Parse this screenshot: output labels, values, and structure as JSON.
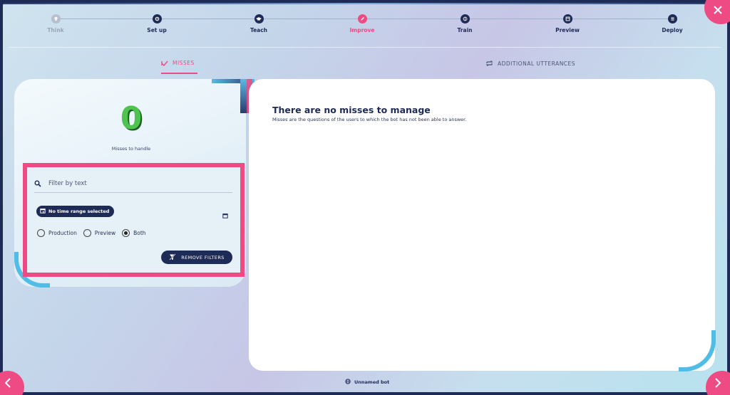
{
  "stepper": {
    "steps": [
      {
        "label": "Think",
        "state": "muted",
        "icon": "lightbulb-icon"
      },
      {
        "label": "Set up",
        "state": "done",
        "icon": "gear-icon"
      },
      {
        "label": "Teach",
        "state": "done",
        "icon": "graduation-cap-icon"
      },
      {
        "label": "Improve",
        "state": "active",
        "icon": "pencil-icon"
      },
      {
        "label": "Train",
        "state": "done",
        "icon": "brain-icon"
      },
      {
        "label": "Preview",
        "state": "done",
        "icon": "window-icon"
      },
      {
        "label": "Deploy",
        "state": "done",
        "icon": "list-icon"
      }
    ]
  },
  "tabs": {
    "misses": "MISSES",
    "additional": "ADDITIONAL UTTERANCES"
  },
  "counter": {
    "value": "0",
    "label": "Misses to handle"
  },
  "filters": {
    "search_placeholder": "Filter by text",
    "time_range": "No time range selected",
    "radios": [
      {
        "label": "Production",
        "checked": false
      },
      {
        "label": "Preview",
        "checked": false
      },
      {
        "label": "Both",
        "checked": true
      }
    ],
    "remove_label": "REMOVE FILTERS"
  },
  "main": {
    "title": "There are no misses to manage",
    "subtitle": "Misses are the questions of the users to which the bot has not been able to answer."
  },
  "footer": {
    "bot_name": "Unnamed bot"
  },
  "colors": {
    "accent": "#ee4b85",
    "navy": "#1f2b57",
    "success": "#4fc34f",
    "deco_blue": "#4fbde6"
  }
}
